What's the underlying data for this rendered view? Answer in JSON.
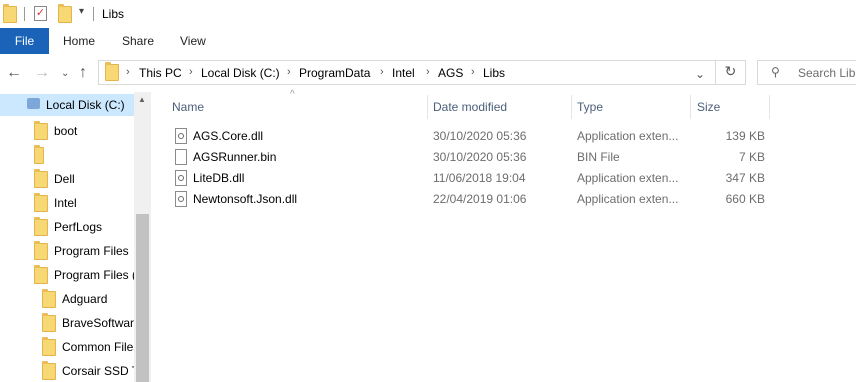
{
  "titlebar": {
    "title": "Libs"
  },
  "ribbon": {
    "tabs": [
      "File",
      "Home",
      "Share",
      "View"
    ]
  },
  "address": {
    "crumbs": [
      "This PC",
      "Local Disk (C:)",
      "ProgramData",
      "Intel",
      "AGS",
      "Libs"
    ],
    "search_placeholder": "Search Libs"
  },
  "nav": {
    "items": [
      {
        "label": "Local Disk (C:)"
      },
      {
        "label": "boot"
      },
      {
        "label": ""
      },
      {
        "label": "Dell"
      },
      {
        "label": "Intel"
      },
      {
        "label": "PerfLogs"
      },
      {
        "label": "Program Files"
      },
      {
        "label": "Program Files ("
      },
      {
        "label": "Adguard"
      },
      {
        "label": "BraveSoftware"
      },
      {
        "label": "Common Files"
      },
      {
        "label": "Corsair SSD To"
      }
    ]
  },
  "columns": {
    "name": "Name",
    "date": "Date modified",
    "type": "Type",
    "size": "Size"
  },
  "files": [
    {
      "name": "AGS.Core.dll",
      "date": "30/10/2020 05:36",
      "type": "Application exten...",
      "size": "139 KB",
      "icon": "dll-file-icon"
    },
    {
      "name": "AGSRunner.bin",
      "date": "30/10/2020 05:36",
      "type": "BIN File",
      "size": "7 KB",
      "icon": "file-icon"
    },
    {
      "name": "LiteDB.dll",
      "date": "11/06/2018 19:04",
      "type": "Application exten...",
      "size": "347 KB",
      "icon": "dll-file-icon"
    },
    {
      "name": "Newtonsoft.Json.dll",
      "date": "22/04/2019 01:06",
      "type": "Application exten...",
      "size": "660 KB",
      "icon": "dll-file-icon"
    }
  ],
  "colors": {
    "accent": "#1a63b8",
    "selection": "#cce8ff",
    "folder": "#f8d775"
  }
}
